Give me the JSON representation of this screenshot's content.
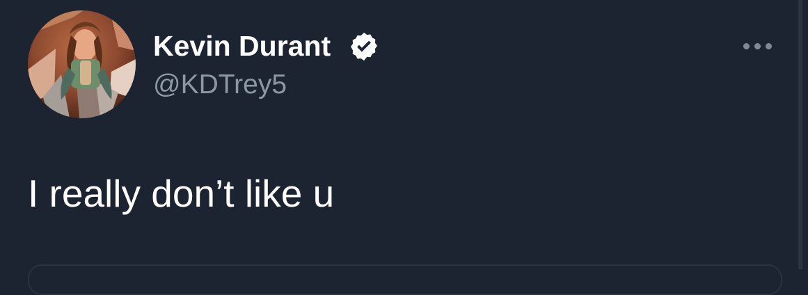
{
  "tweet": {
    "author": {
      "display_name": "Kevin Durant",
      "handle": "@KDTrey5",
      "verified": true
    },
    "text": "I really don’t like u"
  },
  "colors": {
    "background": "#1b2430",
    "primary_text": "#ffffff",
    "secondary_text": "#8c98a4",
    "icon": "#7f8a96"
  },
  "icons": {
    "verified": "verified-badge-icon",
    "more": "more-horizontal-icon"
  }
}
